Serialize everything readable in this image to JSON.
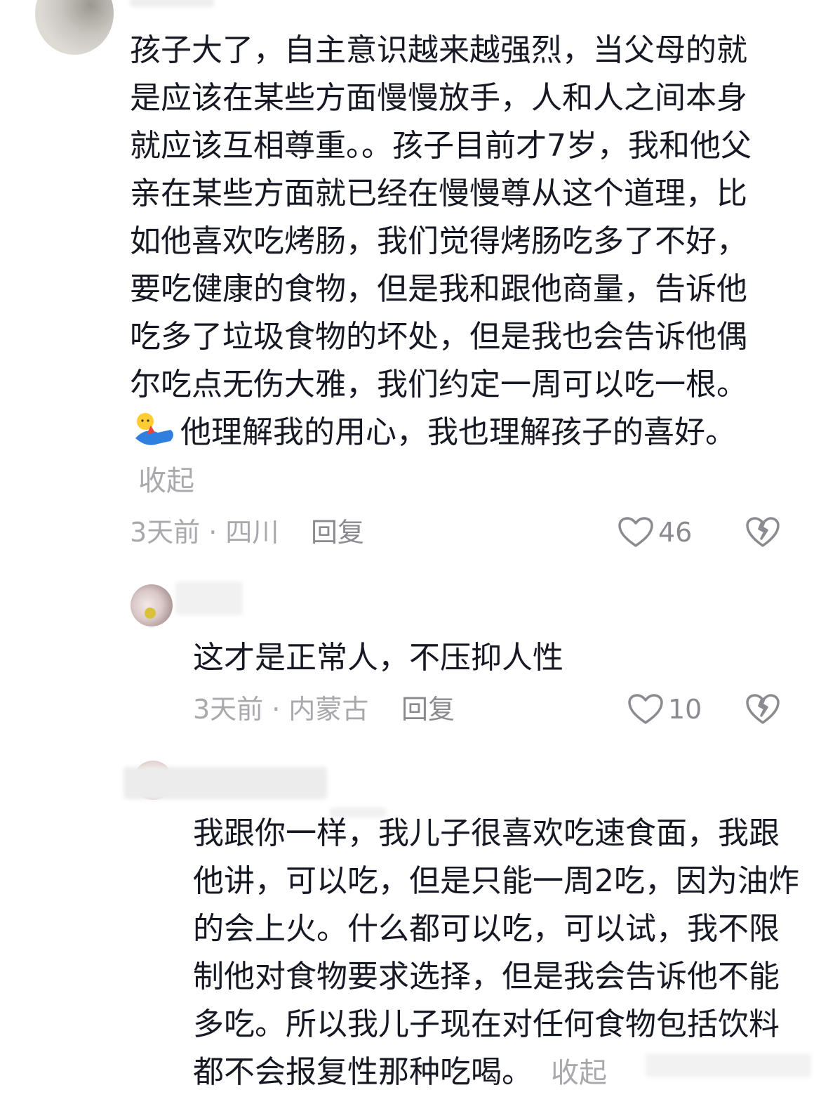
{
  "comments": [
    {
      "text_before_emoji": "孩子大了，自主意识越来越强烈，当父母的就是应该在某些方面慢慢放手，人和人之间本身就应该互相尊重。。孩子目前才7岁，我和他父亲在某些方面就已经在慢慢尊从这个道理，比如他喜欢吃烤肠，我们觉得烤肠吃多了不好，要吃健康的食物，但是我和跟他商量，告诉他吃多了垃圾食物的坏处，但是我也会告诉他偶尔吃点无伤大雅，我们约定一周可以吃一根。",
      "emoji": "lying-down-emoji",
      "text_after_emoji": "他理解我的用心，我也理解孩子的喜好。",
      "collapse_label": "收起",
      "meta": "3天前 · 四川",
      "reply_label": "回复",
      "likes": "46"
    },
    {
      "text": "这才是正常人，不压抑人性",
      "meta": "3天前 · 内蒙古",
      "reply_label": "回复",
      "likes": "10"
    },
    {
      "text": "我跟你一样，我儿子很喜欢吃速食面，我跟他讲，可以吃，但是只能一周2吃，因为油炸的会上火。什么都可以吃，可以试，我不限制他对食物要求选择，但是我会告诉他不能多吃。所以我儿子现在对任何食物包括饮料都不会报复性那种吃喝。",
      "collapse_label": "收起"
    }
  ],
  "icons": {
    "like": "heart-outline-icon",
    "dislike": "broken-heart-icon"
  },
  "colors": {
    "text": "#161823",
    "meta": "#a8a8ad",
    "action": "#8a8a90"
  }
}
